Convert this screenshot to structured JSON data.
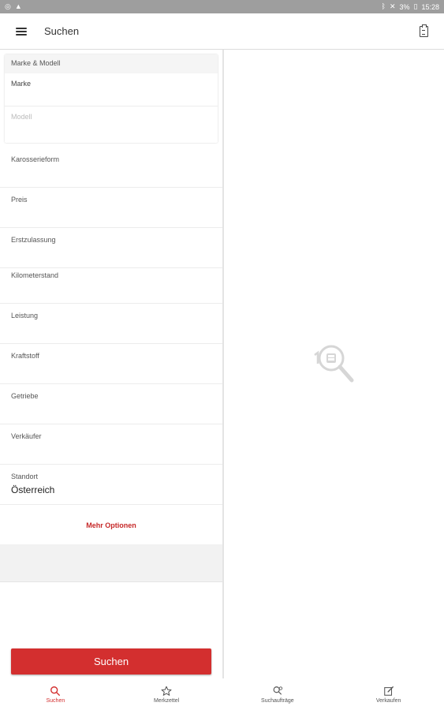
{
  "status": {
    "battery_text": "3%",
    "time": "15:28"
  },
  "header": {
    "title": "Suchen"
  },
  "card": {
    "header": "Marke & Modell",
    "marke_label": "Marke",
    "modell_label": "Modell"
  },
  "rows": [
    {
      "label": "Karosserieform"
    },
    {
      "label": "Preis"
    },
    {
      "label": "Erstzulassung"
    },
    {
      "label": "Kilometerstand"
    },
    {
      "label": "Leistung"
    },
    {
      "label": "Kraftstoff"
    },
    {
      "label": "Getriebe"
    },
    {
      "label": "Verkäufer"
    },
    {
      "label": "Standort",
      "value": "Österreich"
    }
  ],
  "more_options": "Mehr Optionen",
  "search_button": "Suchen",
  "nav": [
    {
      "label": "Suchen",
      "icon": "search-icon",
      "active": true
    },
    {
      "label": "Merkzettel",
      "icon": "star-icon",
      "active": false
    },
    {
      "label": "Suchaufträge",
      "icon": "saved-search-icon",
      "active": false
    },
    {
      "label": "Verkaufen",
      "icon": "edit-icon",
      "active": false
    }
  ],
  "colors": {
    "accent": "#d32f2f",
    "statusbar": "#9e9e9e"
  }
}
